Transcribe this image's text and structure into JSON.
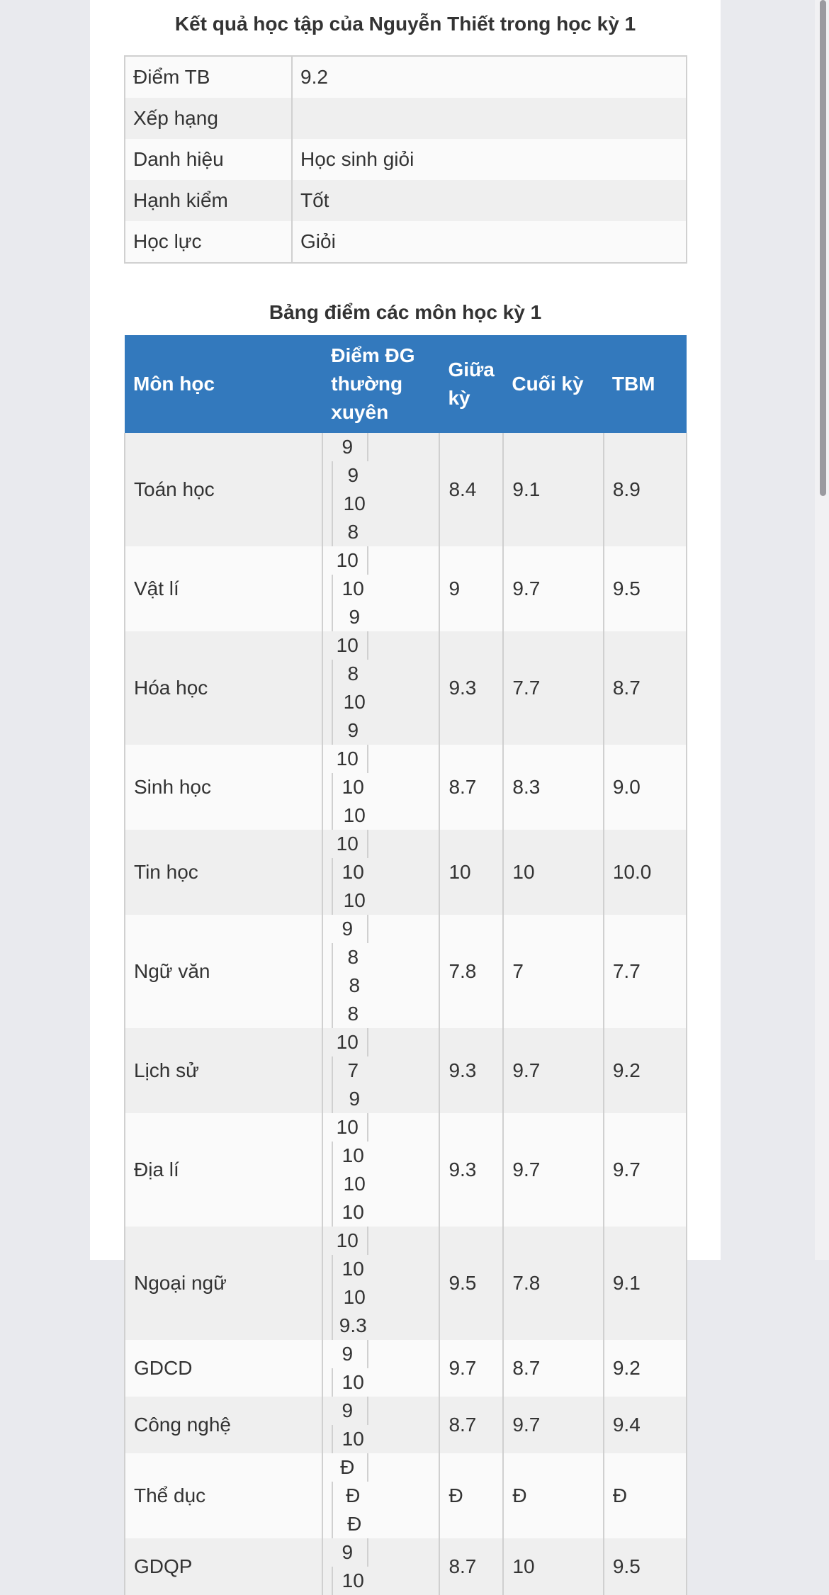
{
  "main_title": "Kết quả học tập của Nguyễn Thiết trong học kỳ 1",
  "summary": [
    {
      "label": "Điểm TB",
      "value": "9.2"
    },
    {
      "label": "Xếp hạng",
      "value": ""
    },
    {
      "label": "Danh hiệu",
      "value": "Học sinh giỏi"
    },
    {
      "label": "Hạnh kiểm",
      "value": "Tốt"
    },
    {
      "label": "Học lực",
      "value": "Giỏi"
    }
  ],
  "grades_title": "Bảng điểm các môn học kỳ 1",
  "headers": [
    "Môn học",
    "Điểm ĐG thường xuyên",
    "Giữa kỳ",
    "Cuối kỳ",
    "TBM"
  ],
  "rows": [
    {
      "subject": "Toán học",
      "tx": [
        "9",
        "9",
        "10",
        "8"
      ],
      "gk": "8.4",
      "ck": "9.1",
      "tbm": "8.9"
    },
    {
      "subject": "Vật lí",
      "tx": [
        "10",
        "10",
        "9"
      ],
      "gk": "9",
      "ck": "9.7",
      "tbm": "9.5"
    },
    {
      "subject": "Hóa học",
      "tx": [
        "10",
        "8",
        "10",
        "9"
      ],
      "gk": "9.3",
      "ck": "7.7",
      "tbm": "8.7"
    },
    {
      "subject": "Sinh học",
      "tx": [
        "10",
        "10",
        "10"
      ],
      "gk": "8.7",
      "ck": "8.3",
      "tbm": "9.0"
    },
    {
      "subject": "Tin học",
      "tx": [
        "10",
        "10",
        "10"
      ],
      "gk": "10",
      "ck": "10",
      "tbm": "10.0"
    },
    {
      "subject": "Ngữ văn",
      "tx": [
        "9",
        "8",
        "8",
        "8"
      ],
      "gk": "7.8",
      "ck": "7",
      "tbm": "7.7"
    },
    {
      "subject": "Lịch sử",
      "tx": [
        "10",
        "7",
        "9"
      ],
      "gk": "9.3",
      "ck": "9.7",
      "tbm": "9.2"
    },
    {
      "subject": "Địa lí",
      "tx": [
        "10",
        "10",
        "10",
        "10"
      ],
      "gk": "9.3",
      "ck": "9.7",
      "tbm": "9.7"
    },
    {
      "subject": "Ngoại ngữ",
      "tx": [
        "10",
        "10",
        "10",
        "9.3"
      ],
      "gk": "9.5",
      "ck": "7.8",
      "tbm": "9.1"
    },
    {
      "subject": "GDCD",
      "tx": [
        "9",
        "10"
      ],
      "gk": "9.7",
      "ck": "8.7",
      "tbm": "9.2"
    },
    {
      "subject": "Công nghệ",
      "tx": [
        "9",
        "10"
      ],
      "gk": "8.7",
      "ck": "9.7",
      "tbm": "9.4"
    },
    {
      "subject": "Thể dục",
      "tx": [
        "Đ",
        "Đ",
        "Đ"
      ],
      "gk": "Đ",
      "ck": "Đ",
      "tbm": "Đ"
    },
    {
      "subject": "GDQP",
      "tx": [
        "9",
        "10"
      ],
      "gk": "8.7",
      "ck": "10",
      "tbm": "9.5"
    }
  ]
}
